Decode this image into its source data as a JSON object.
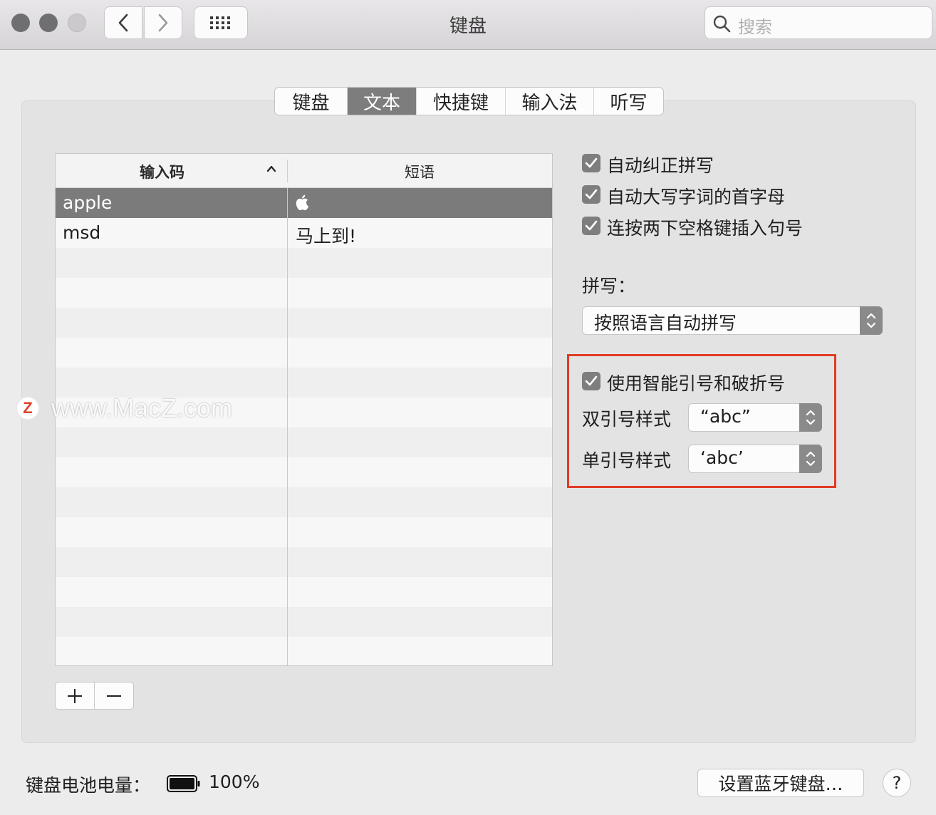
{
  "window": {
    "title": "键盘",
    "search_placeholder": "搜索"
  },
  "tabs": [
    {
      "label": "键盘",
      "active": false
    },
    {
      "label": "文本",
      "active": true
    },
    {
      "label": "快捷键",
      "active": false
    },
    {
      "label": "输入法",
      "active": false
    },
    {
      "label": "听写",
      "active": false
    }
  ],
  "table": {
    "col_input": "输入码",
    "col_phrase": "短语",
    "rows": [
      {
        "input": "apple",
        "phrase": "",
        "phrase_icon": "apple-logo-icon",
        "selected": true
      },
      {
        "input": "msd",
        "phrase": "马上到!",
        "selected": false
      }
    ]
  },
  "options": {
    "auto_correct": {
      "label": "自动纠正拼写",
      "checked": true
    },
    "auto_capitalize": {
      "label": "自动大写字词的首字母",
      "checked": true
    },
    "double_space_period": {
      "label": "连按两下空格键插入句号",
      "checked": true
    },
    "spelling_label": "拼写：",
    "spelling_value": "按照语言自动拼写",
    "smart_quotes": {
      "label": "使用智能引号和破折号",
      "checked": true
    },
    "double_quote_label": "双引号样式",
    "double_quote_value": "“abc”",
    "single_quote_label": "单引号样式",
    "single_quote_value": "‘abc’"
  },
  "footer": {
    "battery_label": "键盘电池电量：",
    "battery_value": "100%",
    "bluetooth_button": "设置蓝牙键盘…",
    "help_button": "?"
  },
  "watermark": {
    "logo_letter": "Z",
    "text": "www.MacZ.com"
  },
  "colors": {
    "selected_row": "#7b7b7b",
    "highlight_border": "#e03b24",
    "checkbox": "#7e7e7e"
  }
}
